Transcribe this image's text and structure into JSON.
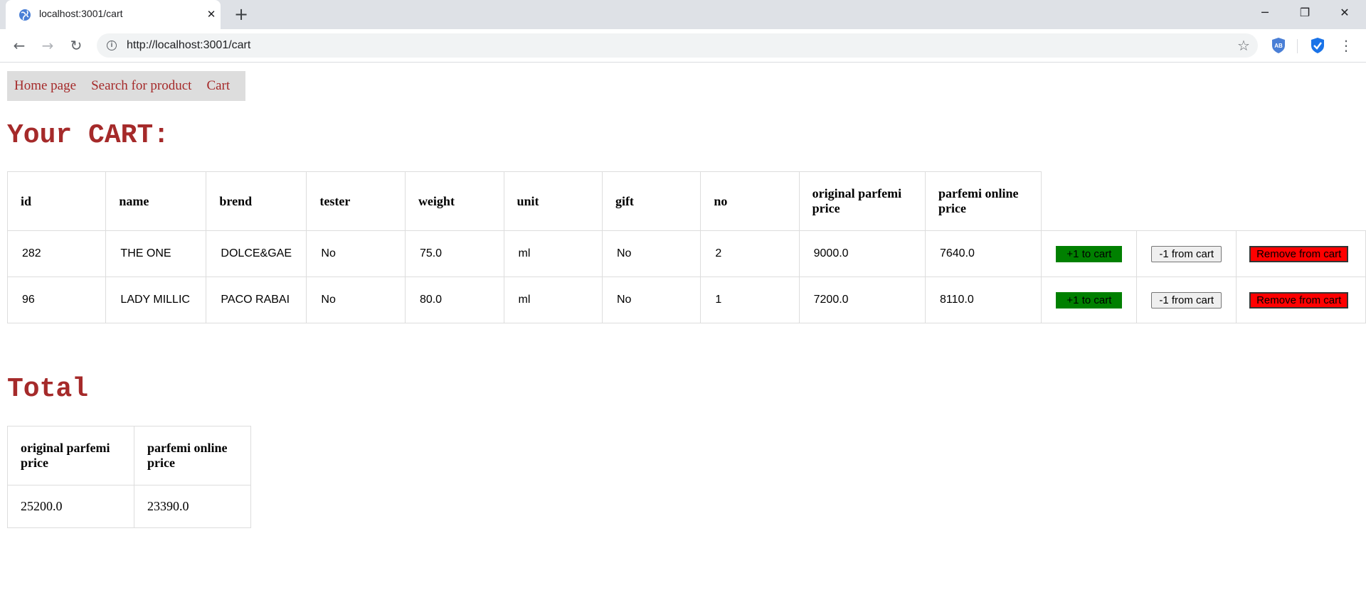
{
  "browser": {
    "tab_title": "localhost:3001/cart",
    "url": "http://localhost:3001/cart",
    "close_glyph": "✕",
    "new_tab_glyph": "+",
    "back_glyph": "←",
    "forward_glyph": "→",
    "reload_glyph": "↻",
    "star_glyph": "☆",
    "menu_glyph": "⋮",
    "info_glyph": "i",
    "minimize_glyph": "─",
    "restore_glyph": "❐",
    "window_close_glyph": "✕",
    "extension_abp_text": "AB",
    "accent_color": "#1a73e8"
  },
  "nav": {
    "links": [
      "Home page",
      "Search for product",
      "Cart"
    ],
    "link_color": "#a52a2a",
    "background": "#dddddd"
  },
  "cart": {
    "heading": "Your CART:",
    "columns": [
      "id",
      "name",
      "brend",
      "tester",
      "weight",
      "unit",
      "gift",
      "no",
      "original parfemi price",
      "parfemi online price"
    ],
    "rows": [
      {
        "id": "282",
        "name": "THE ONE",
        "brend": "DOLCE&GAE",
        "tester": "No",
        "weight": "75.0",
        "unit": "ml",
        "gift": "No",
        "no": "2",
        "original_price": "9000.0",
        "online_price": "7640.0"
      },
      {
        "id": "96",
        "name": "LADY MILLIC",
        "brend": "PACO RABAI",
        "tester": "No",
        "weight": "80.0",
        "unit": "ml",
        "gift": "No",
        "no": "1",
        "original_price": "7200.0",
        "online_price": "8110.0"
      }
    ],
    "actions": {
      "add_label": "+1 to cart",
      "minus_label": "-1 from cart",
      "remove_label": "Remove from cart",
      "add_color": "#008000",
      "remove_color": "#ff0000"
    }
  },
  "totals": {
    "heading": "Total",
    "columns": [
      "original parfemi price",
      "parfemi online price"
    ],
    "values": [
      "25200.0",
      "23390.0"
    ]
  },
  "theme": {
    "heading_color": "#a52a2a",
    "border_color": "#dddddd"
  }
}
